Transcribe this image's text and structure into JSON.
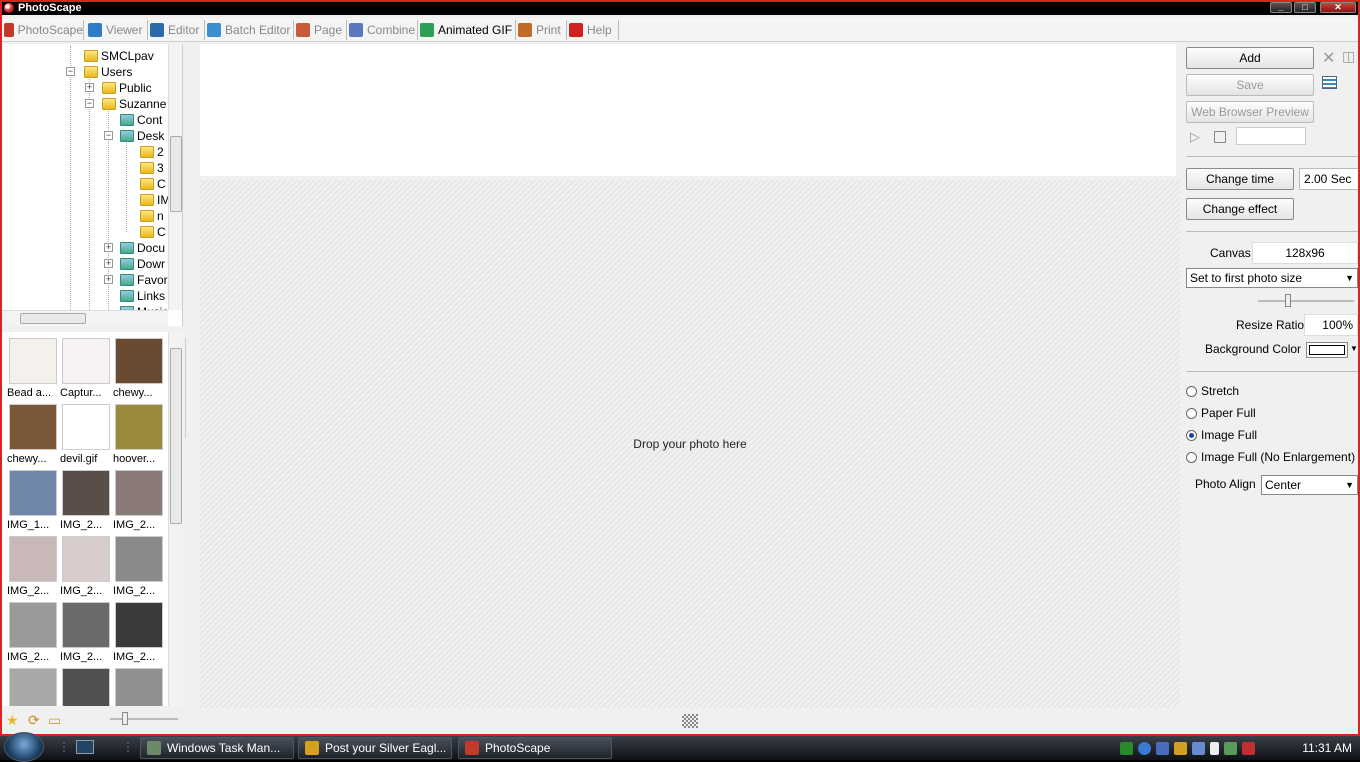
{
  "window": {
    "title": "PhotoScape",
    "min": "_",
    "max": "□",
    "close": "✕"
  },
  "menu": [
    {
      "label": "PhotoScape",
      "color": "#c0392b"
    },
    {
      "label": "Viewer",
      "color": "#2e7dc4"
    },
    {
      "label": "Editor",
      "color": "#2a6aa8"
    },
    {
      "label": "Batch Editor",
      "color": "#3a8fd0"
    },
    {
      "label": "Page",
      "color": "#c85a3a"
    },
    {
      "label": "Combine",
      "color": "#5a78c0"
    },
    {
      "label": "Animated GIF",
      "color": "#2e9d56"
    },
    {
      "label": "Print",
      "color": "#c06a2a"
    },
    {
      "label": "Help",
      "color": "#d02020"
    }
  ],
  "tree": [
    {
      "label": "SMCLpav",
      "expander": ""
    },
    {
      "label": "Users",
      "expander": "⊟"
    },
    {
      "label": "Public",
      "expander": "⊞"
    },
    {
      "label": "Suzanne",
      "expander": "⊟"
    },
    {
      "label": "Cont",
      "expander": ""
    },
    {
      "label": "Desk",
      "expander": "⊟"
    },
    {
      "label": "2",
      "expander": ""
    },
    {
      "label": "3",
      "expander": ""
    },
    {
      "label": "C",
      "expander": ""
    },
    {
      "label": "IM",
      "expander": ""
    },
    {
      "label": "n",
      "expander": ""
    },
    {
      "label": "C",
      "expander": ""
    },
    {
      "label": "Docu",
      "expander": "⊞"
    },
    {
      "label": "Dowr",
      "expander": "⊞"
    },
    {
      "label": "Favor",
      "expander": "⊞"
    },
    {
      "label": "Links",
      "expander": ""
    },
    {
      "label": "Music",
      "expander": ""
    }
  ],
  "thumbnails": [
    {
      "caption": "Bead a...",
      "color": "#f4f0ec"
    },
    {
      "caption": "Captur...",
      "color": "#f7f2f2"
    },
    {
      "caption": "chewy...",
      "color": "#6b4a32"
    },
    {
      "caption": "chewy...",
      "color": "#7a5838"
    },
    {
      "caption": "devil.gif",
      "color": "#ffffff"
    },
    {
      "caption": "hoover...",
      "color": "#9a8a3a"
    },
    {
      "caption": "IMG_1...",
      "color": "#6f86a8"
    },
    {
      "caption": "IMG_2...",
      "color": "#5a4e48"
    },
    {
      "caption": "IMG_2...",
      "color": "#8a7a78"
    },
    {
      "caption": "IMG_2...",
      "color": "#c8b8b8"
    },
    {
      "caption": "IMG_2...",
      "color": "#d8cccc"
    },
    {
      "caption": "IMG_2...",
      "color": "#8a8a8a"
    },
    {
      "caption": "IMG_2...",
      "color": "#9a9a9a"
    },
    {
      "caption": "IMG_2...",
      "color": "#6a6a6a"
    },
    {
      "caption": "IMG_2...",
      "color": "#3a3a3a"
    },
    {
      "caption": "",
      "color": "#a8a8a8"
    },
    {
      "caption": "",
      "color": "#505050"
    },
    {
      "caption": "",
      "color": "#909090"
    }
  ],
  "canvas": {
    "drop_text": "Drop your photo here"
  },
  "right": {
    "add": "Add",
    "save": "Save",
    "web_preview": "Web Browser Preview",
    "change_time": "Change time",
    "time_value": "2.00 Sec",
    "change_effect": "Change effect",
    "canvas_label": "Canvas",
    "canvas_value": "128x96",
    "size_select": "Set to first photo size",
    "resize_label": "Resize Ratio",
    "resize_value": "100%",
    "bg_label": "Background Color",
    "radios": [
      {
        "label": "Stretch",
        "checked": false
      },
      {
        "label": "Paper Full",
        "checked": false
      },
      {
        "label": "Image Full",
        "checked": true
      },
      {
        "label": "Image Full (No Enlargement)",
        "checked": false
      }
    ],
    "align_label": "Photo Align",
    "align_value": "Center"
  },
  "taskbar": {
    "tasks": [
      {
        "label": "Windows Task Man...",
        "color": "#6a8a6a"
      },
      {
        "label": "Post your Silver Eagl...",
        "color": "#d8a020"
      },
      {
        "label": "PhotoScape",
        "color": "#c0392b"
      }
    ],
    "clock": "11:31 AM"
  }
}
